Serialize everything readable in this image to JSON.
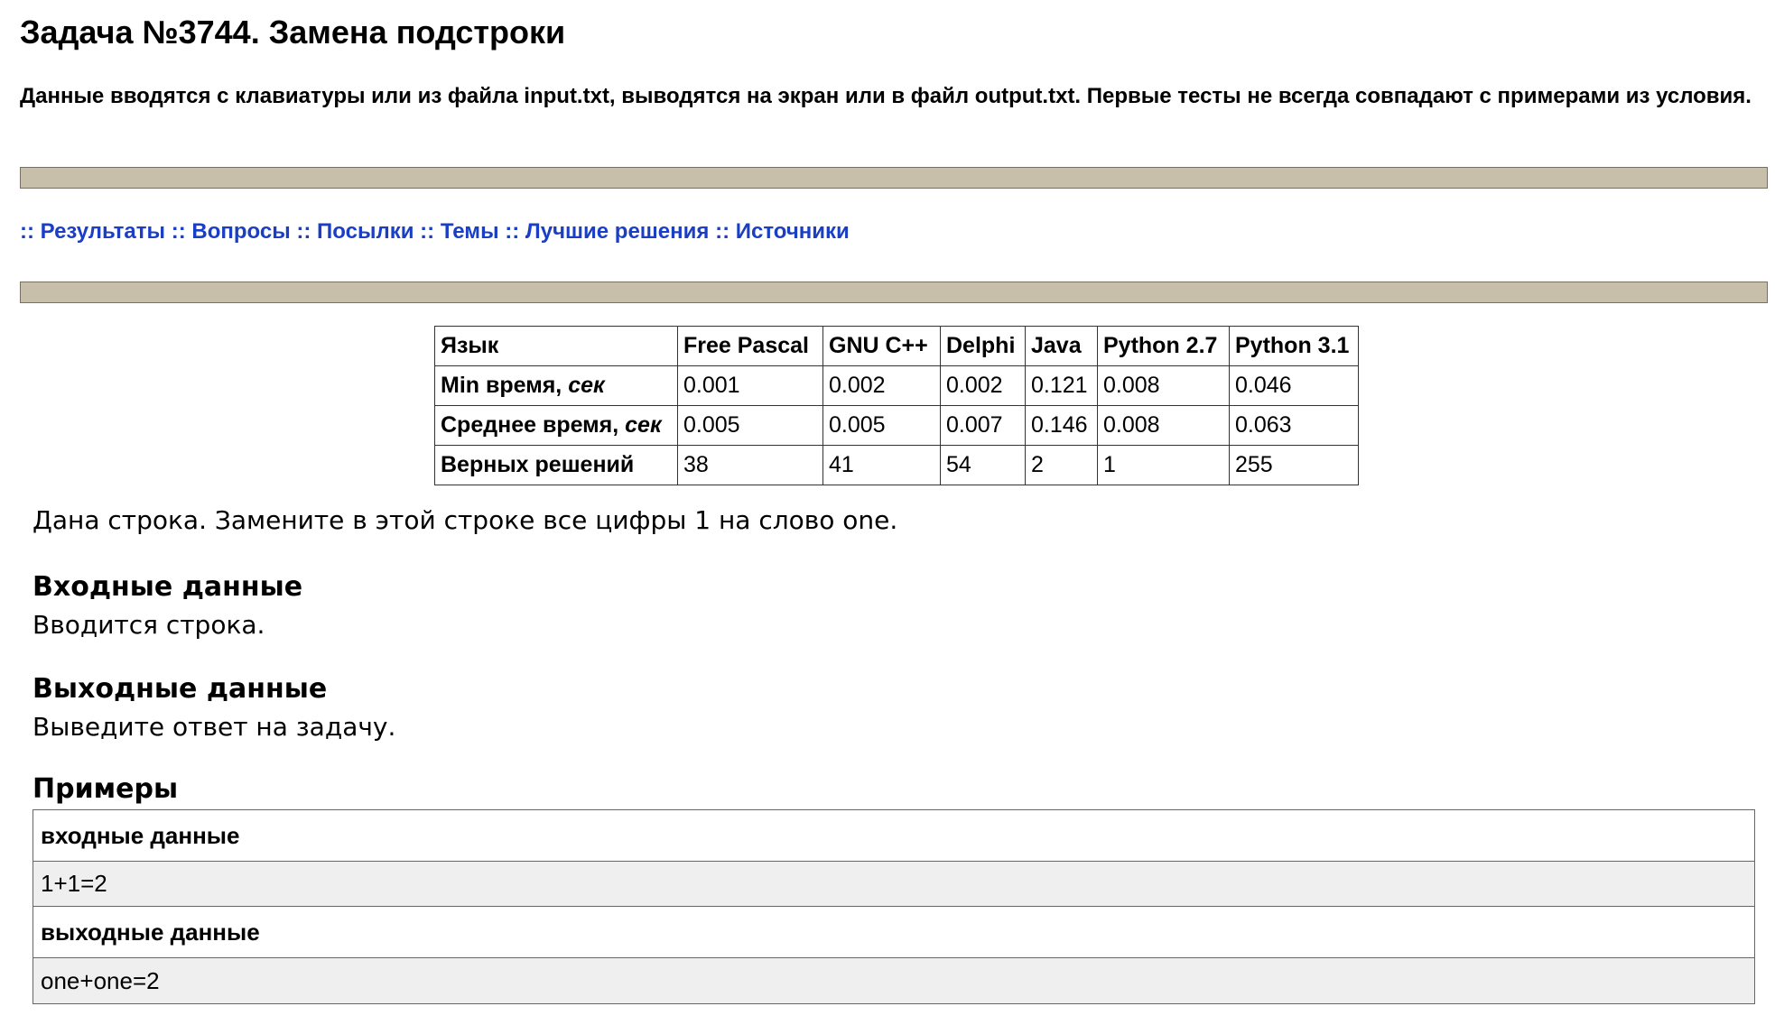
{
  "problem": {
    "title": "Задача №3744. Замена подстроки",
    "io_note": "Данные вводятся с клавиатуры или из файла input.txt, выводятся на экран или в файл output.txt. Первые тесты не всегда совпадают с примерами из условия."
  },
  "nav": {
    "separator": "::",
    "links": [
      "Результаты",
      "Вопросы",
      "Посылки",
      "Темы",
      "Лучшие решения",
      "Источники"
    ]
  },
  "stats": {
    "header_label": "Язык",
    "languages": [
      "Free Pascal",
      "GNU C++",
      "Delphi",
      "Java",
      "Python 2.7",
      "Python 3.1"
    ],
    "rows": [
      {
        "label": "Min время,",
        "unit": "сек",
        "values": [
          "0.001",
          "0.002",
          "0.002",
          "0.121",
          "0.008",
          "0.046"
        ]
      },
      {
        "label": "Среднее время,",
        "unit": "сек",
        "values": [
          "0.005",
          "0.005",
          "0.007",
          "0.146",
          "0.008",
          "0.063"
        ]
      },
      {
        "label": "Верных решений",
        "unit": "",
        "values": [
          "38",
          "41",
          "54",
          "2",
          "1",
          "255"
        ]
      }
    ]
  },
  "statement": "Дана строка. Замените в этой строке все цифры 1 на слово one.",
  "input_section": {
    "heading": "Входные данные",
    "text": "Вводится строка."
  },
  "output_section": {
    "heading": "Выходные данные",
    "text": "Выведите ответ на задачу."
  },
  "examples": {
    "heading": "Примеры",
    "input_label": "входные данные",
    "input_value": "1+1=2",
    "output_label": "выходные данные",
    "output_value": "one+one=2"
  },
  "colors": {
    "bar": "#c8bfaa",
    "link": "#1a3fc4",
    "example_value_bg": "#efefef"
  }
}
